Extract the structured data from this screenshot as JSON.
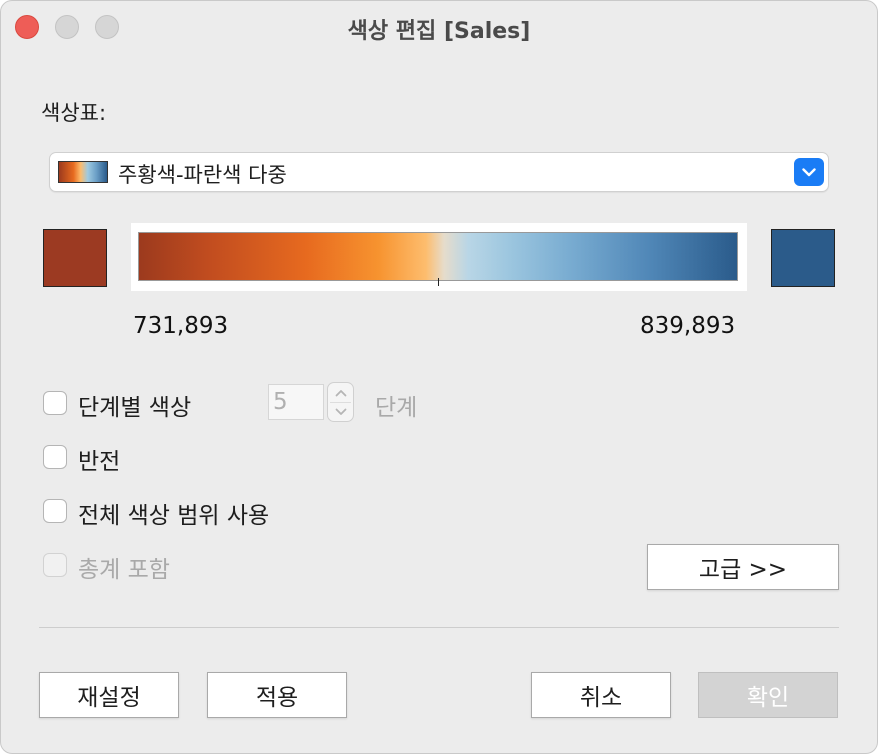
{
  "window": {
    "title": "색상 편집 [Sales]"
  },
  "palette": {
    "label": "색상표:",
    "selected": "주황색-파란색 다중"
  },
  "range": {
    "start_color": "#9c3a22",
    "end_color": "#2b5b8a",
    "min_value": "731,893",
    "max_value": "839,893"
  },
  "options": {
    "stepped": {
      "label": "단계별 색상",
      "checked": false
    },
    "steps": {
      "value": "5",
      "unit": "단계"
    },
    "reverse": {
      "label": "반전",
      "checked": false
    },
    "full_range": {
      "label": "전체 색상 범위 사용",
      "checked": false
    },
    "include_totals": {
      "label": "총계 포함",
      "checked": false,
      "disabled": true
    }
  },
  "buttons": {
    "advanced": "고급 >>",
    "reset": "재설정",
    "apply": "적용",
    "cancel": "취소",
    "ok": "확인"
  },
  "icons": {
    "dropdown": "chevron-down-icon",
    "step_up": "chevron-up-icon",
    "step_down": "chevron-down-icon"
  }
}
